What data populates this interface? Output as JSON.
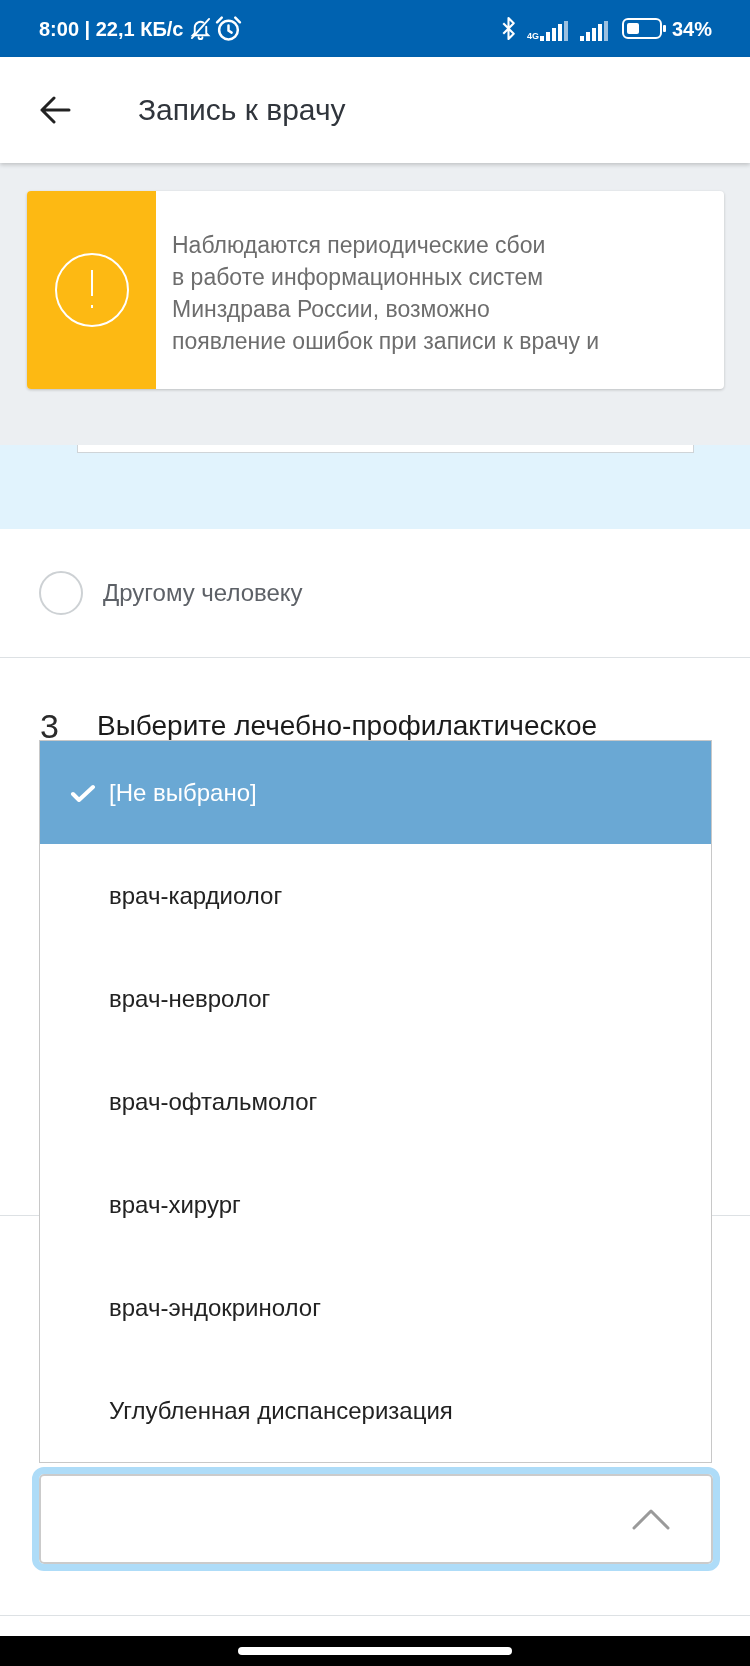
{
  "status_bar": {
    "time_and_speed": "8:00 | 22,1 КБ/с",
    "network_type": "4G",
    "battery_percent": "34%"
  },
  "header": {
    "title": "Запись к врачу"
  },
  "notice": {
    "lines": [
      "Наблюдаются периодические сбои",
      "в работе информационных систем",
      "Минздрава России, возможно",
      "появление ошибок при записи к врачу и"
    ]
  },
  "recipient_options": [
    {
      "label": "Другому человеку",
      "selected": false
    }
  ],
  "step": {
    "number": "3",
    "title": "Выберите лечебно-профилактическое"
  },
  "dropdown": {
    "options": [
      {
        "label": "[Не выбрано]",
        "selected": true
      },
      {
        "label": "врач-кардиолог",
        "selected": false
      },
      {
        "label": "врач-невролог",
        "selected": false
      },
      {
        "label": "врач-офтальмолог",
        "selected": false
      },
      {
        "label": "врач-хирург",
        "selected": false
      },
      {
        "label": "врач-эндокринолог",
        "selected": false
      },
      {
        "label": "Углубленная диспансеризация",
        "selected": false
      }
    ]
  },
  "select_field": {
    "expanded": true
  }
}
